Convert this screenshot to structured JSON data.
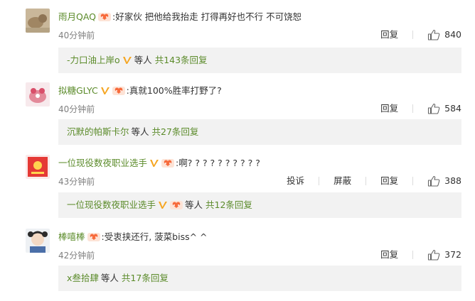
{
  "comments": [
    {
      "username": "雨月QAQ",
      "badges": [
        "heart-mascot"
      ],
      "text": "好家伙 把他给我抬走 打得再好也不行 不可饶恕",
      "time": "40分钟前",
      "actions": [
        "回复"
      ],
      "likes": "840",
      "replies": {
        "name": "-力口油上岸o",
        "badges": [
          "v"
        ],
        "middle": "等人",
        "total": "共143条回复"
      }
    },
    {
      "username": "拟糖GLYC",
      "badges": [
        "v",
        "heart-mascot"
      ],
      "text": "真就100%胜率打野了?",
      "time": "40分钟前",
      "actions": [
        "回复"
      ],
      "likes": "584",
      "replies": {
        "name": "沉默的帕斯卡尔",
        "badges": [],
        "middle": "等人",
        "total": "共27条回复"
      }
    },
    {
      "username": "一位现役数夜职业选手",
      "badges": [
        "v",
        "heart-mascot"
      ],
      "text": "啊? ? ? ? ? ? ? ? ? ?",
      "time": "43分钟前",
      "actions": [
        "投诉",
        "屏蔽",
        "回复"
      ],
      "likes": "388",
      "replies": {
        "name": "一位现役数夜职业选手",
        "badges": [
          "v",
          "heart-mascot"
        ],
        "middle": "等人",
        "total": "共12条回复"
      }
    },
    {
      "username": "棒嘻棒",
      "badges": [
        "heart-mascot"
      ],
      "text": "受衷挟还行, 菠菜biss^ ^",
      "time": "42分钟前",
      "actions": [
        "回复"
      ],
      "likes": "372",
      "replies": {
        "name": "x叁拾肆",
        "badges": [],
        "middle": "等人",
        "total": "共17条回复"
      }
    }
  ],
  "colors": {
    "username": "#5b8b2a",
    "reply_bg": "#f2f2f2",
    "time": "#808080",
    "v_badge": "#f5a623",
    "heart_badge": "#f76b3c"
  },
  "icons": [
    "thumbs-up-icon",
    "v-badge-icon",
    "heart-mascot-badge-icon"
  ]
}
